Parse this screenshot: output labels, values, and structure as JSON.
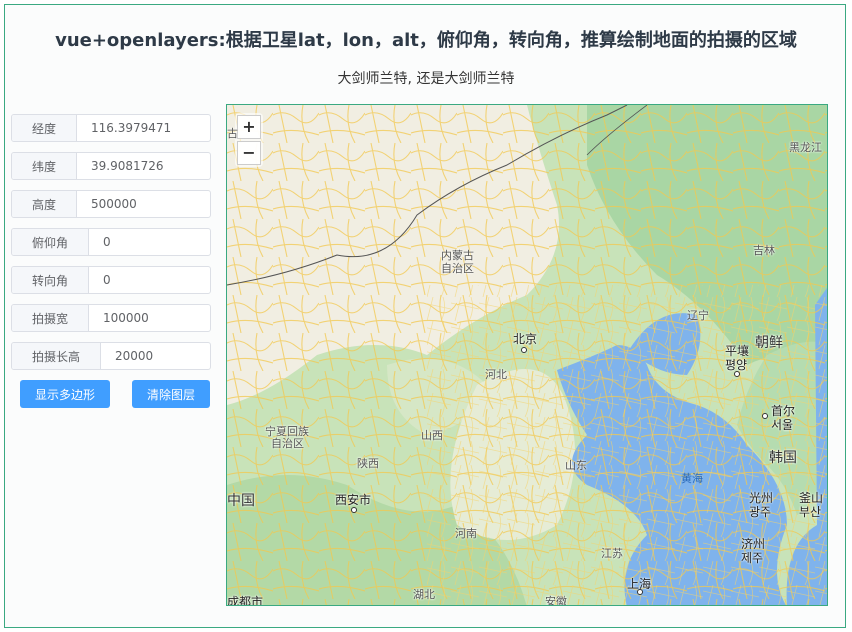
{
  "title": "vue+openlayers:根据卫星lat，lon，alt，俯仰角，转向角，推算绘制地面的拍摄的区域",
  "subtitle": "大剑师兰特, 还是大剑师兰特",
  "form": {
    "fields": [
      {
        "label": "经度",
        "value": "116.3979471"
      },
      {
        "label": "纬度",
        "value": "39.9081726"
      },
      {
        "label": "高度",
        "value": "500000"
      },
      {
        "label": "俯仰角",
        "value": "0"
      },
      {
        "label": "转向角",
        "value": "0"
      },
      {
        "label": "拍摄宽",
        "value": "100000"
      },
      {
        "label": "拍摄长高",
        "value": "20000"
      }
    ]
  },
  "buttons": {
    "show_polygon": "显示多边形",
    "clear_layers": "清除图层"
  },
  "map": {
    "zoom_in": "+",
    "zoom_out": "−",
    "labels": {
      "heilongjiang": "黑龙江",
      "jilin": "吉林",
      "liaoning": "辽宁",
      "inner_mongolia_1": "内蒙古",
      "inner_mongolia_2": "自治区",
      "beijing": "北京",
      "hebei": "河北",
      "north_korea": "朝鲜",
      "pyongyang_1": "平壤",
      "pyongyang_2": "평양",
      "seoul_1": "首尔",
      "seoul_2": "서울",
      "south_korea": "韩国",
      "ningxia_1": "宁夏回族",
      "ningxia_2": "自治区",
      "shanxi": "山西",
      "shaanxi": "陕西",
      "shandong": "山东",
      "yellow_sea": "黄海",
      "china": "中国",
      "xian": "西安市",
      "henan": "河南",
      "jiangsu": "江苏",
      "shanghai": "上海",
      "hubei": "湖北",
      "anhui": "安徽",
      "chengdu": "成都市",
      "gwangju_1": "光州",
      "gwangju_2": "광주",
      "busan_1": "釜山",
      "busan_2": "부산",
      "jeju_1": "济州",
      "jeju_2": "제주",
      "gu": "古"
    },
    "colors": {
      "land": "#eef1de",
      "green": "#b5dcb0",
      "water": "#7fb3ec",
      "road": "#f2c84f"
    }
  }
}
